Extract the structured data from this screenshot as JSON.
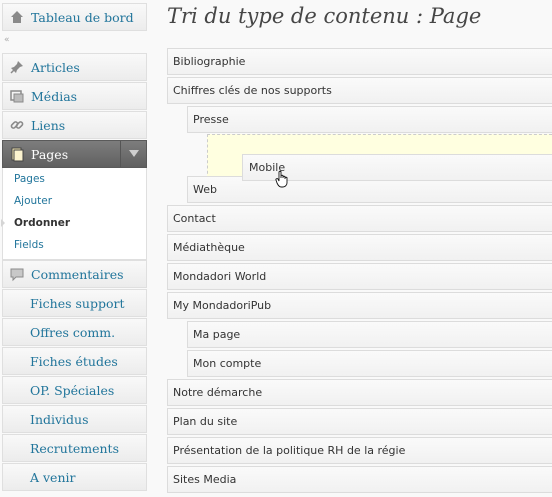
{
  "sidebar": {
    "dashboard_label": "Tableau de bord",
    "items": [
      {
        "label": "Articles",
        "icon": "pin-icon"
      },
      {
        "label": "Médias",
        "icon": "media-icon"
      },
      {
        "label": "Liens",
        "icon": "link-icon"
      }
    ],
    "pages": {
      "label": "Pages",
      "submenu": [
        "Pages",
        "Ajouter",
        "Ordonner",
        "Fields"
      ],
      "current": "Ordonner"
    },
    "comments_label": "Commentaires",
    "custom_items": [
      "Fiches support",
      "Offres comm.",
      "Fiches études",
      "OP. Spéciales",
      "Individus",
      "Recrutements",
      "A venir"
    ]
  },
  "main": {
    "title": "Tri du type de contenu : Page",
    "rows": [
      "Bibliographie",
      "Chiffres clés de nos supports",
      "Presse",
      "Web",
      "Contact",
      "Médiathèque",
      "Mondadori World",
      "My MondadoriPub",
      "Ma page",
      "Mon compte",
      "Notre démarche",
      "Plan du site",
      "Présentation de la politique RH de la régie",
      "Sites Media"
    ],
    "dragged_item": "Mobile"
  },
  "colors": {
    "link": "#21759b",
    "active_menu": "#6d6d6d",
    "placeholder": "#ffffe0"
  }
}
